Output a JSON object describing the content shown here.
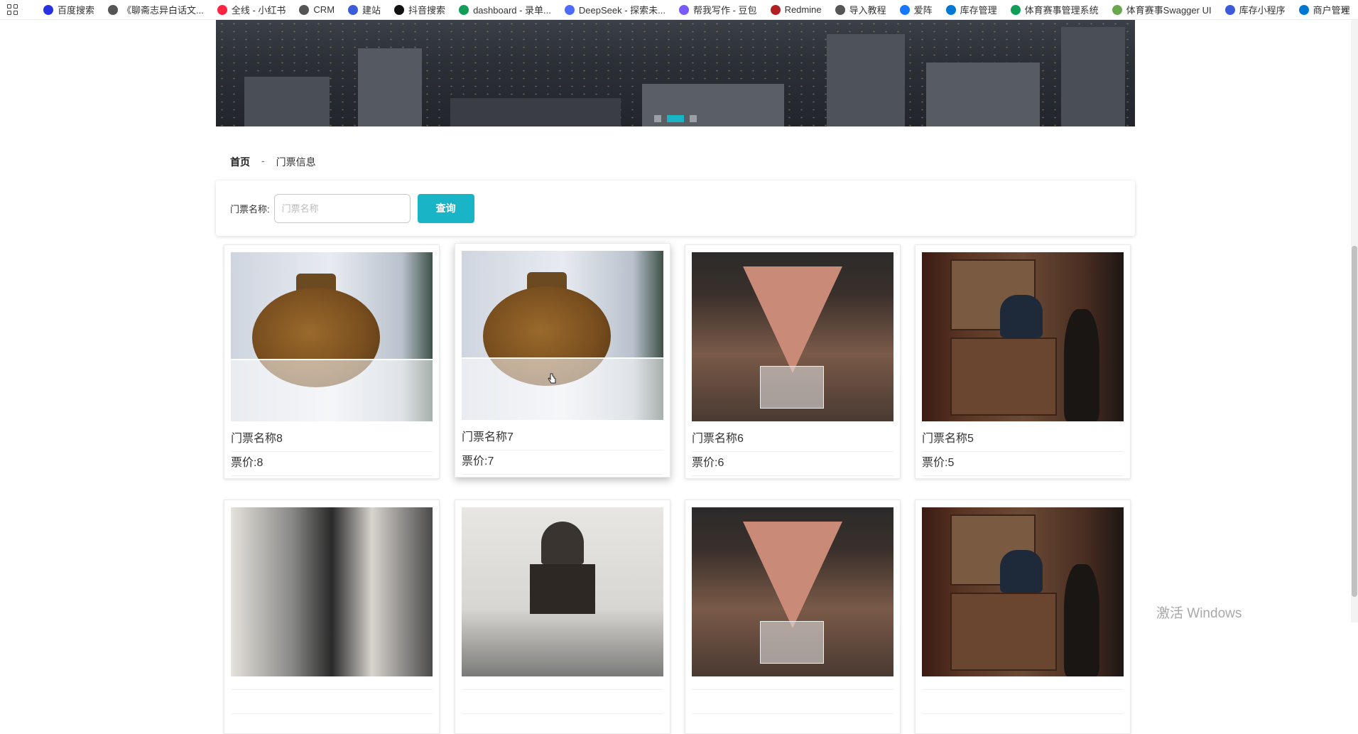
{
  "bookmarks": [
    {
      "label": "百度搜索",
      "color": "#2932e1"
    },
    {
      "label": "《聊斋志异白话文...",
      "color": "#555555"
    },
    {
      "label": "全线 - 小红书",
      "color": "#ff2442"
    },
    {
      "label": "CRM",
      "color": "#555555"
    },
    {
      "label": "建站",
      "color": "#3b5bdb"
    },
    {
      "label": "抖音搜索",
      "color": "#111111"
    },
    {
      "label": "dashboard - 录单...",
      "color": "#0f9d58"
    },
    {
      "label": "DeepSeek - 探索未...",
      "color": "#4d6bfe"
    },
    {
      "label": "帮我写作 - 豆包",
      "color": "#7a5af8"
    },
    {
      "label": "Redmine",
      "color": "#b32024"
    },
    {
      "label": "导入教程",
      "color": "#555555"
    },
    {
      "label": "爱阵",
      "color": "#1677ff"
    },
    {
      "label": "库存管理",
      "color": "#0078d4"
    },
    {
      "label": "体育赛事管理系统",
      "color": "#0f9d58"
    },
    {
      "label": "体育赛事Swagger UI",
      "color": "#6aa84f"
    },
    {
      "label": "库存小程序",
      "color": "#3b5bdb"
    },
    {
      "label": "商户管理",
      "color": "#0078d4"
    }
  ],
  "carousel": {
    "total": 3,
    "active": 2
  },
  "breadcrumb": {
    "home": "首页",
    "separator": "-",
    "current": "门票信息"
  },
  "search": {
    "label": "门票名称:",
    "placeholder": "门票名称",
    "button": "查询"
  },
  "accent_color": "#19b4c6",
  "tickets": [
    {
      "name": "门票名称8",
      "price": "票价:8",
      "image": "vase"
    },
    {
      "name": "门票名称7",
      "price": "票价:7",
      "image": "vase"
    },
    {
      "name": "门票名称6",
      "price": "票价:6",
      "image": "museum-hall"
    },
    {
      "name": "门票名称5",
      "price": "票价:5",
      "image": "shop-figure"
    },
    {
      "name": "",
      "price": "",
      "image": "gallery"
    },
    {
      "name": "",
      "price": "",
      "image": "temple-model"
    },
    {
      "name": "",
      "price": "",
      "image": "museum-hall"
    },
    {
      "name": "",
      "price": "",
      "image": "shop-figure"
    }
  ],
  "os_watermark": "激活 Windows"
}
